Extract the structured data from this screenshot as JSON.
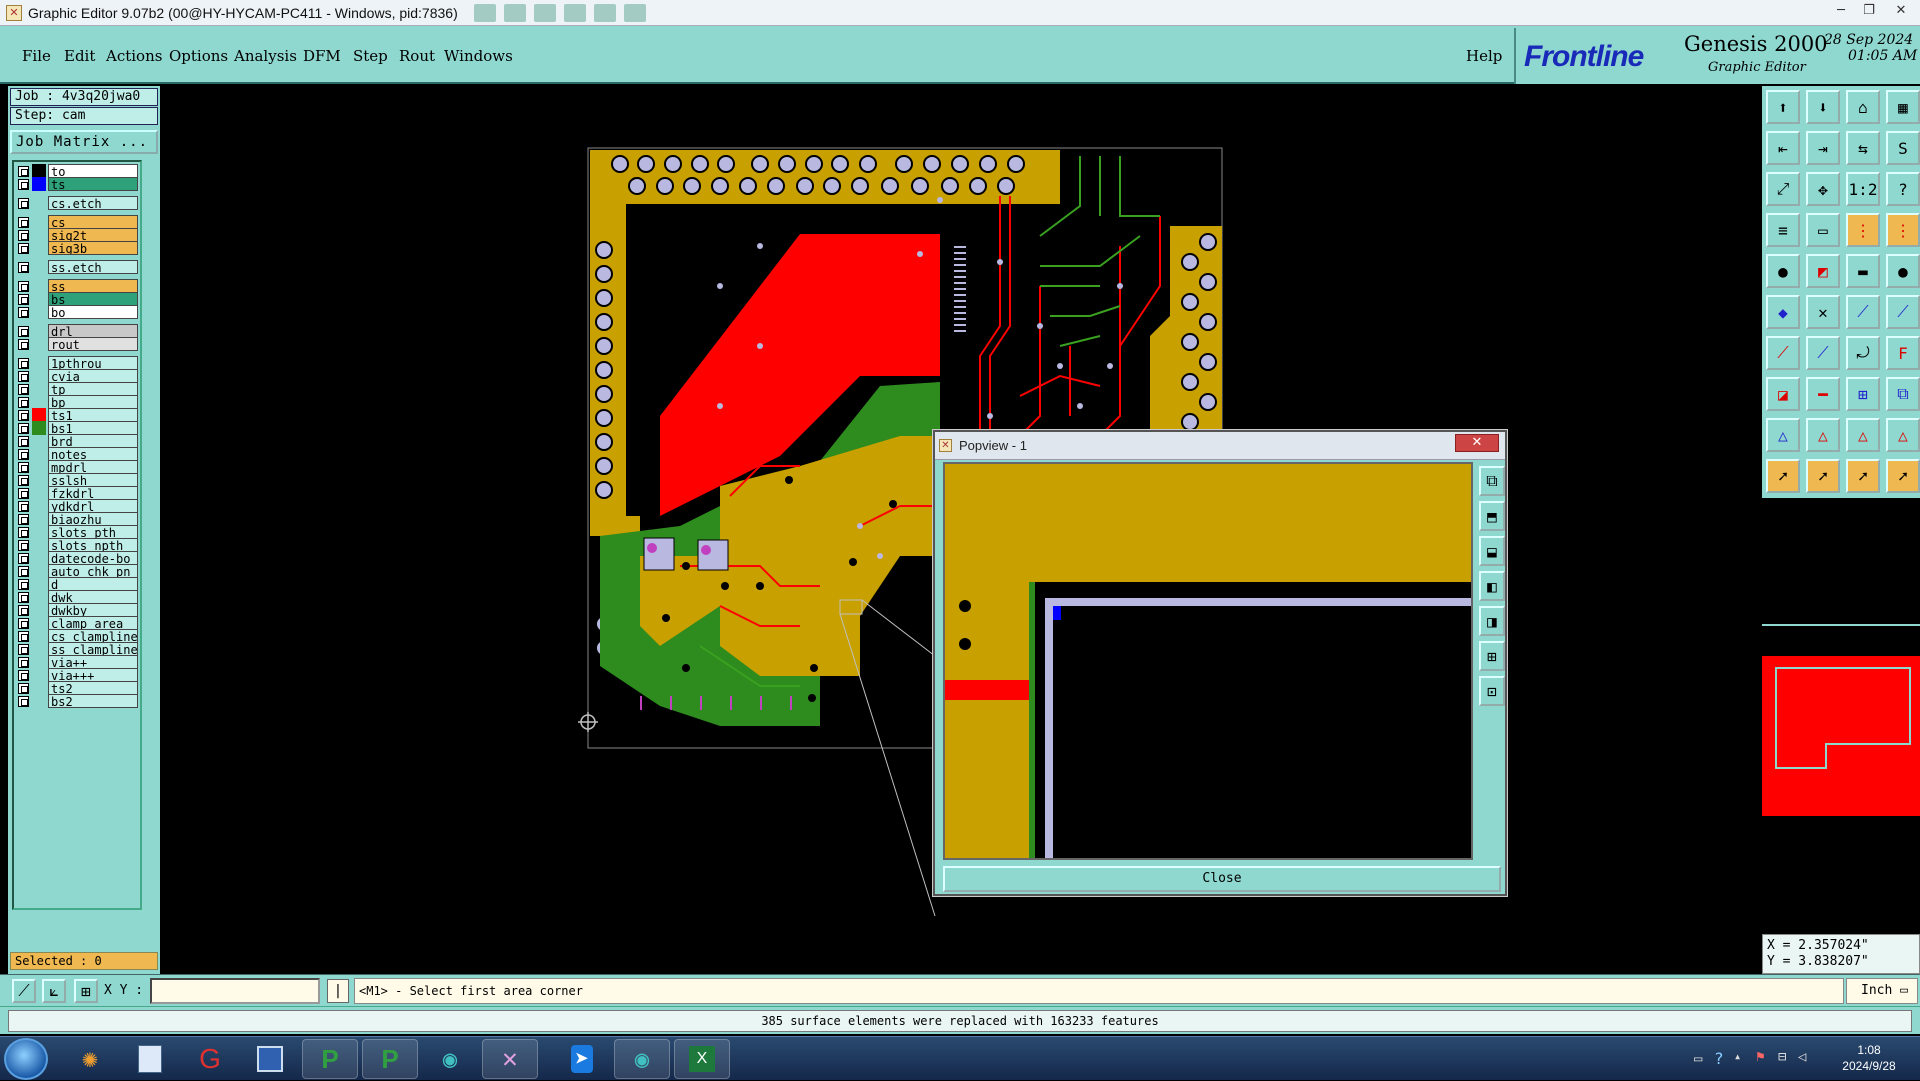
{
  "window": {
    "title": "Graphic Editor 9.07b2 (00@HY-HYCAM-PC411 - Windows, pid:7836)",
    "controls": [
      "minimize-icon",
      "restore-icon",
      "close-icon"
    ]
  },
  "menu": [
    "File",
    "Edit",
    "Actions",
    "Options",
    "Analysis",
    "DFM",
    "Step",
    "Rout",
    "Windows"
  ],
  "help": "Help",
  "brand": {
    "logo": "Frontline",
    "product": "Genesis 2000",
    "subtitle": "Graphic Editor",
    "date": "28 Sep 2024",
    "time": "01:05 AM"
  },
  "job": {
    "job_label": "Job : 4v3q20jwa0",
    "step_label": "Step: cam",
    "matrix_button": "Job Matrix ..."
  },
  "layers": [
    {
      "name": "to",
      "color": "#000000",
      "bg": "#ffffff"
    },
    {
      "name": "ts",
      "color": "#0000ff",
      "bg": "#2ea07a"
    },
    {
      "name": "cs.etch",
      "color": "",
      "bg": "#bfeee8"
    },
    {
      "name": "cs",
      "color": "",
      "bg": "#f0b850"
    },
    {
      "name": "sig2t",
      "color": "",
      "bg": "#f0b850"
    },
    {
      "name": "sig3b",
      "color": "",
      "bg": "#f0b850"
    },
    {
      "name": "ss.etch",
      "color": "",
      "bg": "#bfeee8"
    },
    {
      "name": "ss",
      "color": "",
      "bg": "#f0b850"
    },
    {
      "name": "bs",
      "color": "",
      "bg": "#2ea07a"
    },
    {
      "name": "bo",
      "color": "",
      "bg": "#ffffff"
    },
    {
      "name": "drl",
      "color": "",
      "bg": "#c8c8c8"
    },
    {
      "name": "rout",
      "color": "",
      "bg": "#e0e0e0"
    },
    {
      "name": "1pthrou",
      "color": "",
      "bg": "#bfeee8"
    },
    {
      "name": "cvia",
      "color": "",
      "bg": "#bfeee8"
    },
    {
      "name": "tp",
      "color": "",
      "bg": "#bfeee8"
    },
    {
      "name": "bp",
      "color": "",
      "bg": "#bfeee8"
    },
    {
      "name": "ts1",
      "color": "#ff0000",
      "bg": "#bfeee8"
    },
    {
      "name": "bs1",
      "color": "#2e8b1e",
      "bg": "#bfeee8"
    },
    {
      "name": "brd",
      "color": "",
      "bg": "#bfeee8"
    },
    {
      "name": "notes",
      "color": "",
      "bg": "#bfeee8"
    },
    {
      "name": "mpdrl",
      "color": "",
      "bg": "#bfeee8"
    },
    {
      "name": "sslsh",
      "color": "",
      "bg": "#bfeee8"
    },
    {
      "name": "fzkdrl",
      "color": "",
      "bg": "#bfeee8"
    },
    {
      "name": "ydkdrl",
      "color": "",
      "bg": "#bfeee8"
    },
    {
      "name": "biaozhu",
      "color": "",
      "bg": "#bfeee8"
    },
    {
      "name": "slots_pth",
      "color": "",
      "bg": "#bfeee8"
    },
    {
      "name": "slots_npth",
      "color": "",
      "bg": "#bfeee8"
    },
    {
      "name": "datecode-bo",
      "color": "",
      "bg": "#bfeee8"
    },
    {
      "name": "auto_chk_pn",
      "color": "",
      "bg": "#bfeee8"
    },
    {
      "name": "d",
      "color": "",
      "bg": "#bfeee8"
    },
    {
      "name": "dwk",
      "color": "",
      "bg": "#bfeee8"
    },
    {
      "name": "dwkby",
      "color": "",
      "bg": "#bfeee8"
    },
    {
      "name": "clamp_area",
      "color": "",
      "bg": "#bfeee8"
    },
    {
      "name": "cs_clampline",
      "color": "",
      "bg": "#bfeee8"
    },
    {
      "name": "ss_clampline",
      "color": "",
      "bg": "#bfeee8"
    },
    {
      "name": "via++",
      "color": "",
      "bg": "#bfeee8"
    },
    {
      "name": "via+++",
      "color": "",
      "bg": "#bfeee8"
    },
    {
      "name": "ts2",
      "color": "",
      "bg": "#bfeee8"
    },
    {
      "name": "bs2",
      "color": "",
      "bg": "#bfeee8"
    }
  ],
  "selected": "Selected : 0",
  "popview": {
    "title": "Popview - 1",
    "close": "Close"
  },
  "coords": {
    "x": "X = 2.357024\"",
    "y": "Y = 3.838207\""
  },
  "command": {
    "xy_label": "X Y :",
    "xy_value": "",
    "pipe": "|",
    "prompt": "<M1> - Select first area corner",
    "unit": "Inch ▭"
  },
  "status": "385 surface elements were replaced with 163233 features",
  "taskbar": {
    "time": "1:08",
    "date": "2024/9/28"
  },
  "colors": {
    "panel": "#8ed8d0",
    "copper": "#c8a000",
    "red_layer": "#ff0000",
    "green_layer": "#2e8b1e"
  }
}
